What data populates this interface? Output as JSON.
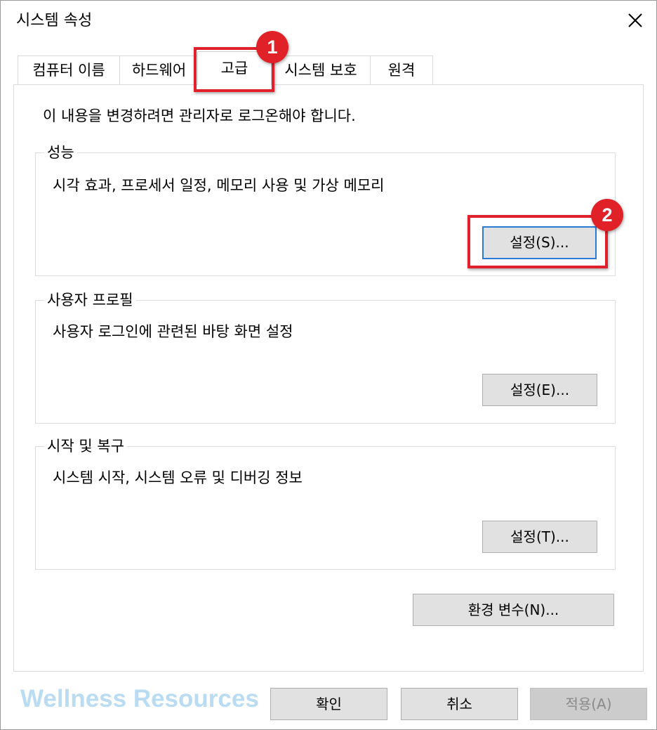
{
  "window": {
    "title": "시스템 속성",
    "close_icon": "close-icon"
  },
  "tabs": [
    {
      "label": "컴퓨터 이름",
      "active": false
    },
    {
      "label": "하드웨어",
      "active": false
    },
    {
      "label": "고급",
      "active": true
    },
    {
      "label": "시스템 보호",
      "active": false
    },
    {
      "label": "원격",
      "active": false
    }
  ],
  "panel": {
    "admin_notice": "이 내용을 변경하려면 관리자로 로그온해야 합니다.",
    "performance": {
      "title": "성능",
      "description": "시각 효과, 프로세서 일정, 메모리 사용 및 가상 메모리",
      "button_label": "설정(S)..."
    },
    "user_profiles": {
      "title": "사용자 프로필",
      "description": "사용자 로그인에 관련된 바탕 화면 설정",
      "button_label": "설정(E)..."
    },
    "startup_recovery": {
      "title": "시작 및 복구",
      "description": "시스템 시작, 시스템 오류 및 디버깅 정보",
      "button_label": "설정(T)..."
    },
    "env_vars_label": "환경 변수(N)..."
  },
  "footer": {
    "ok_label": "확인",
    "cancel_label": "취소",
    "apply_label": "적용(A)"
  },
  "annotations": {
    "step1": "1",
    "step2": "2",
    "color": "#e0202a"
  },
  "watermark": "Wellness Resources"
}
